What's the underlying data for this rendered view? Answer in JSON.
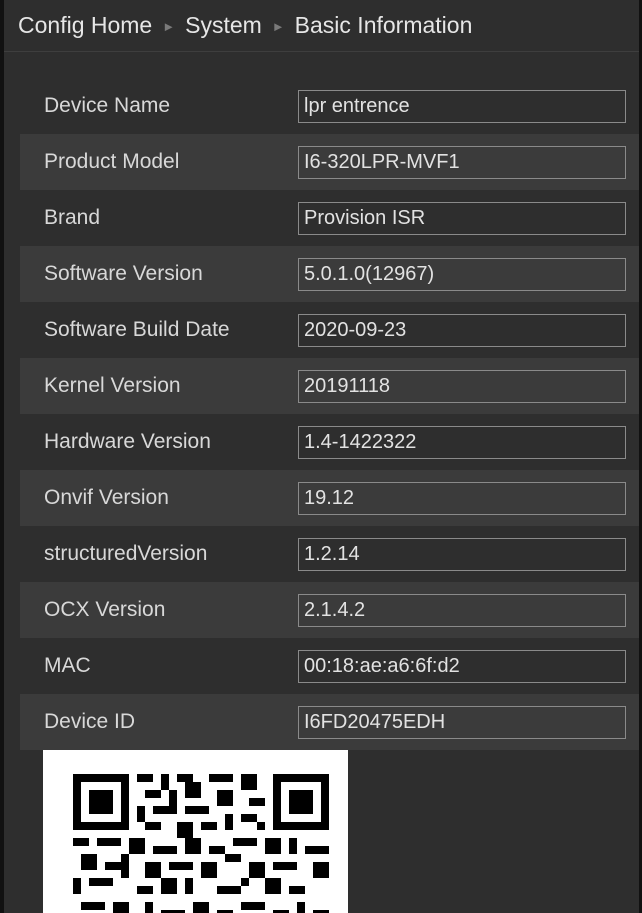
{
  "breadcrumb": {
    "items": [
      "Config Home",
      "System",
      "Basic Information"
    ],
    "separator": "►"
  },
  "info_rows": [
    {
      "label": "Device Name",
      "value": "lpr entrence"
    },
    {
      "label": "Product Model",
      "value": "I6-320LPR-MVF1"
    },
    {
      "label": "Brand",
      "value": "Provision ISR"
    },
    {
      "label": "Software Version",
      "value": "5.0.1.0(12967)"
    },
    {
      "label": "Software Build Date",
      "value": "2020-09-23"
    },
    {
      "label": "Kernel Version",
      "value": "20191118"
    },
    {
      "label": "Hardware Version",
      "value": "1.4-1422322"
    },
    {
      "label": "Onvif Version",
      "value": "19.12"
    },
    {
      "label": "structuredVersion",
      "value": "1.2.14"
    },
    {
      "label": "OCX Version",
      "value": "2.1.4.2"
    },
    {
      "label": "MAC",
      "value": "00:18:ae:a6:6f:d2"
    },
    {
      "label": "Device ID",
      "value": "I6FD20475EDH"
    }
  ],
  "qr_code": {
    "icon": "qr-code-icon"
  },
  "colors": {
    "background": "#2e2e2e",
    "row_alt": "#3b3b3b",
    "field_border": "#8a8a8a",
    "text": "#d8d8d8"
  }
}
